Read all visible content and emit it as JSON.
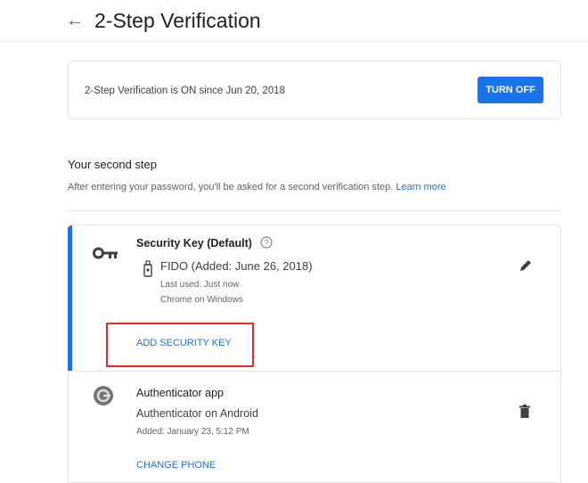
{
  "header": {
    "back_icon": "arrow-back-icon",
    "title": "2-Step Verification"
  },
  "status": {
    "text": "2-Step Verification is ON since Jun 20, 2018",
    "turn_off_label": "TURN OFF"
  },
  "second_step": {
    "heading": "Your second step",
    "description": "After entering your password, you'll be asked for a second verification step.",
    "learn_more": "Learn more"
  },
  "security_key": {
    "icon": "key-icon",
    "title": "Security Key (Default)",
    "help_icon": "help-circle-icon",
    "device_icon": "usb-key-icon",
    "device_label": "FIDO (Added: June 26, 2018)",
    "last_used": "Last used: Just now",
    "browser": "Chrome on Windows",
    "edit_icon": "pencil-icon",
    "add_label": "ADD SECURITY KEY"
  },
  "authenticator": {
    "icon": "authenticator-app-icon",
    "title": "Authenticator app",
    "device": "Authenticator on Android",
    "added": "Added: January 23, 5:12 PM",
    "delete_icon": "trash-icon",
    "change_phone_label": "CHANGE PHONE"
  },
  "colors": {
    "accent": "#1a73e8",
    "highlight_box": "#d93025"
  }
}
